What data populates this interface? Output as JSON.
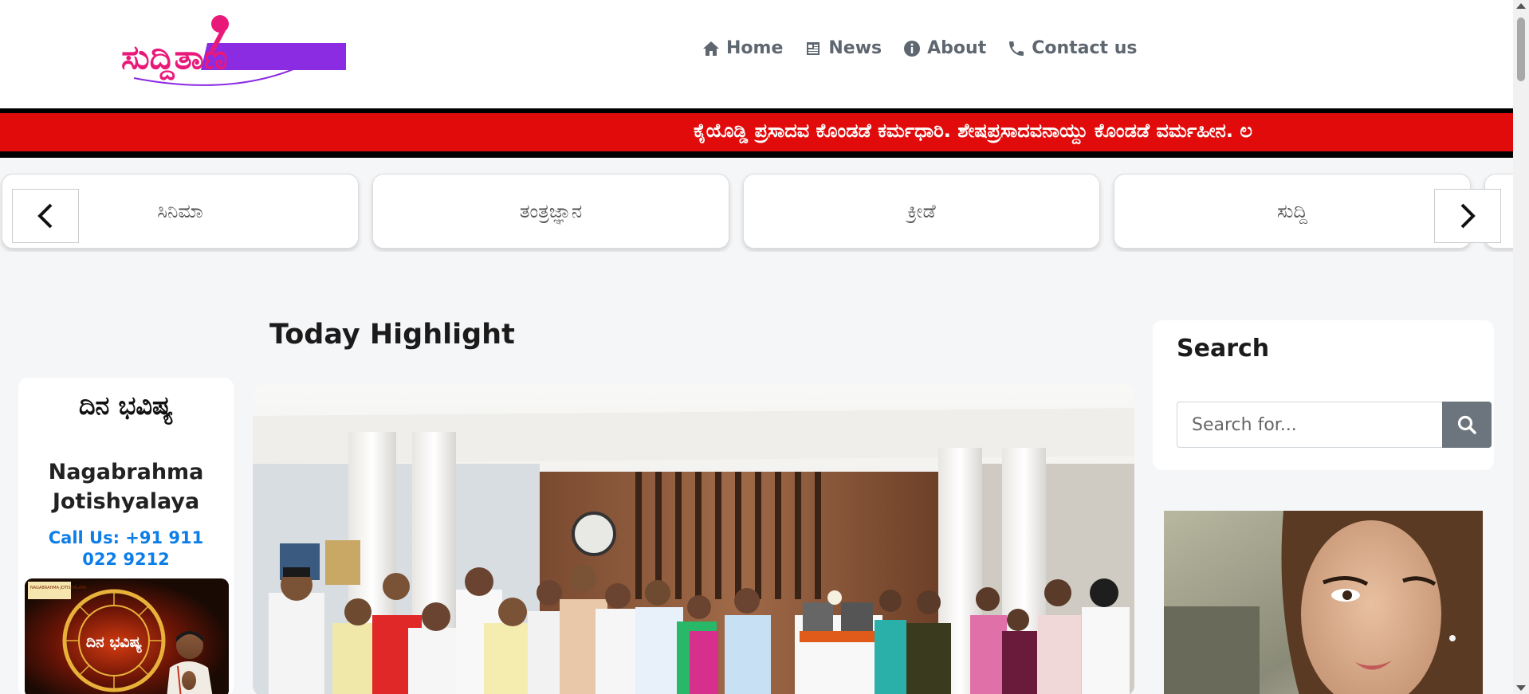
{
  "header": {
    "logo_text": "ಸುದ್ದಿತಾಣ",
    "nav": [
      {
        "label": "Home",
        "icon": "home-icon"
      },
      {
        "label": "News",
        "icon": "newspaper-icon"
      },
      {
        "label": "About",
        "icon": "info-icon"
      },
      {
        "label": "Contact us",
        "icon": "phone-icon"
      }
    ]
  },
  "ticker": {
    "text": "ಕೈಯೊಡ್ಡಿ ಪ್ರಸಾದವ ಕೊಂಡಡೆ ಕರ್ಮಧಾರಿ. ಶೇಷಪ್ರಸಾದವನಾಯ್ದು ಕೊಂಡಡೆ ವರ್ಮಹೀನ. ಲ"
  },
  "categories": [
    "ಸಿನಿಮಾ",
    "ತಂತ್ರಜ್ಞಾನ",
    "ಕ್ರೀಡೆ",
    "ಸುದ್ದಿ"
  ],
  "left": {
    "title": "ದಿನ ಭವಿಷ್ಯ",
    "name_line1": "Nagabrahma",
    "name_line2": "Jotishyalaya",
    "phone": "Call Us: +91 911 022 9212",
    "banner_title": "ದಿನ ಭವಿಷ್ಯ",
    "banner_brand": "NAGABRAHMA JOTISHALAYA"
  },
  "main": {
    "section_title": "Today Highlight"
  },
  "sidebar": {
    "search_title": "Search",
    "search_placeholder": "Search for..."
  },
  "colors": {
    "ticker_bg": "#e10b0b",
    "nav_text": "#5e6670",
    "phone": "#0d7ee8",
    "logo_pink": "#e9197a",
    "logo_purple": "#8b2be2"
  }
}
